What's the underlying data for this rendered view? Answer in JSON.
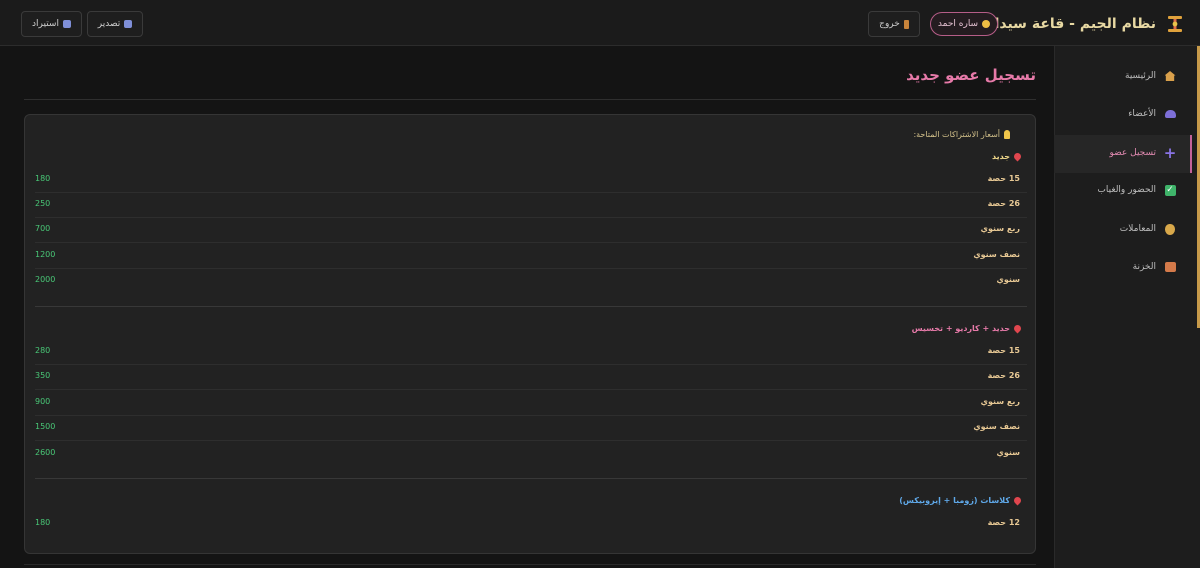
{
  "header": {
    "title": "نظام الجيم - قاعة سيدات",
    "user_name": "ساره احمد",
    "logout_label": "خروج",
    "export_label": "تصدير",
    "import_label": "استيراد"
  },
  "sidebar": {
    "items": [
      {
        "label": "الرئيسية",
        "icon": "home-icon"
      },
      {
        "label": "الأعضاء",
        "icon": "members-icon"
      },
      {
        "label": "تسجيل عضو",
        "icon": "plus-icon"
      },
      {
        "label": "الحضور والغياب",
        "icon": "check-icon"
      },
      {
        "label": "المعاملات",
        "icon": "money-bag-icon"
      },
      {
        "label": "الخزنة",
        "icon": "safe-icon"
      }
    ],
    "active_index": 2
  },
  "main": {
    "title": "تسجيل عضو جديد",
    "hint": "أسعار الاشتراكات المتاحة:",
    "groups": [
      {
        "name": "جديد",
        "color": "#f0d88a",
        "rows": [
          {
            "name": "15 حصة",
            "price": "180"
          },
          {
            "name": "26 حصة",
            "price": "250"
          },
          {
            "name": "ربع سنوي",
            "price": "700"
          },
          {
            "name": "نصف سنوي",
            "price": "1200"
          },
          {
            "name": "سنوي",
            "price": "2000"
          }
        ]
      },
      {
        "name": "حديد + كارديو + تخسيس",
        "color": "#e77aa9",
        "rows": [
          {
            "name": "15 حصة",
            "price": "280"
          },
          {
            "name": "26 حصة",
            "price": "350"
          },
          {
            "name": "ربع سنوي",
            "price": "900"
          },
          {
            "name": "نصف سنوي",
            "price": "1500"
          },
          {
            "name": "سنوي",
            "price": "2600"
          }
        ]
      },
      {
        "name": "كلاسات (زومبا + إيروبيكس)",
        "color": "#5fa8e8",
        "rows": [
          {
            "name": "12 حصة",
            "price": "180"
          }
        ]
      }
    ]
  },
  "colors": {
    "accent_pink": "#e77aa9",
    "accent_gold": "#c79a4a",
    "price_green": "#49c877",
    "background": "#141414"
  }
}
